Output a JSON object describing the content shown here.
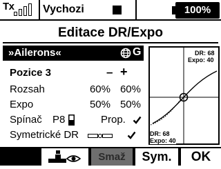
{
  "status_bar": {
    "tx_label": "Tx",
    "signal_levels": [
      1,
      2,
      3,
      4
    ],
    "model_name": "Vychozi",
    "battery_percent": "100%",
    "battery_fill": 1.0
  },
  "page_title": "Editace DR/Expo",
  "function": {
    "label": "»Ailerons«",
    "icon": "globe-icon",
    "badge": "G"
  },
  "position": {
    "label": "Pozice 3",
    "minus": "–",
    "plus": "+"
  },
  "rows": {
    "rate": {
      "label": "Rozsah",
      "left": "60%",
      "right": "60%"
    },
    "expo": {
      "label": "Expo",
      "left": "50%",
      "right": "50%"
    },
    "switch": {
      "label": "Spínač",
      "switch_name": "P8",
      "switch_icon": "switch-icon",
      "prop_label": "Prop.",
      "prop_checked": true,
      "prop_icon": "checkmark-icon"
    },
    "symmetric": {
      "label": "Symetrické DR",
      "icon": "slider-icon",
      "checked": true,
      "check_icon": "checkmark-icon"
    }
  },
  "curve": {
    "top_dr": "DR: 68",
    "top_expo": "Expo: 40",
    "bottom_dr": "DR: 68",
    "bottom_expo": "Expo: 40"
  },
  "softkeys": {
    "key1_icon": "servo-view-icon",
    "key2_label": "Smaž",
    "key3_label": "Sym.",
    "key4_label": "OK"
  }
}
